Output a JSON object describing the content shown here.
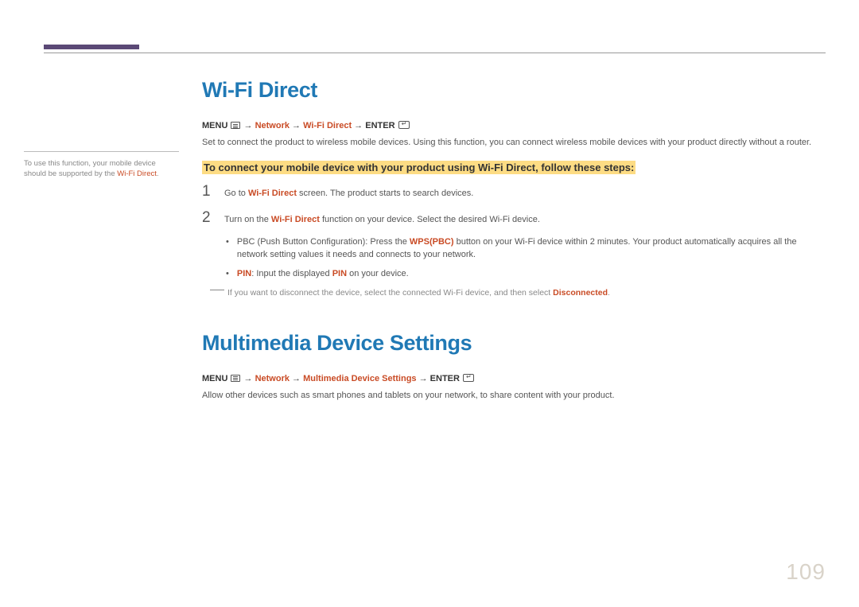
{
  "sidebar": {
    "prefix": "To use this function, your mobile device should be supported by the ",
    "highlight": "Wi-Fi Direct",
    "suffix": "."
  },
  "wifi": {
    "heading": "Wi-Fi Direct",
    "path": {
      "menu": "MENU",
      "arrow": " → ",
      "p1": "Network",
      "p2": "Wi-Fi Direct",
      "enter": "ENTER"
    },
    "desc": "Set to connect the product to wireless mobile devices. Using this function, you can connect wireless mobile devices with your product directly without a router.",
    "steps_title": "To connect your mobile device with your product using Wi-Fi Direct, follow these steps:",
    "step1_num": "1",
    "step1_a": "Go to ",
    "step1_hl": "Wi-Fi Direct",
    "step1_b": " screen. The product starts to search devices.",
    "step2_num": "2",
    "step2_a": "Turn on the ",
    "step2_hl": "Wi-Fi Direct",
    "step2_b": " function on your device. Select the desired Wi-Fi device.",
    "bullet1_a": "PBC (Push Button Configuration): Press the ",
    "bullet1_hl": "WPS(PBC)",
    "bullet1_b": " button on your Wi-Fi device within 2 minutes. Your product automatically acquires all the network setting values it needs and connects to your network.",
    "bullet2_hl1": "PIN",
    "bullet2_a": ": Input the displayed ",
    "bullet2_hl2": "PIN",
    "bullet2_b": " on your device.",
    "note_a": "If you want to disconnect the device, select the connected Wi-Fi device, and then select ",
    "note_hl": "Disconnected",
    "note_b": "."
  },
  "multimedia": {
    "heading": "Multimedia Device Settings",
    "path": {
      "menu": "MENU",
      "arrow": " → ",
      "p1": "Network",
      "p2": "Multimedia Device Settings",
      "enter": "ENTER"
    },
    "desc": "Allow other devices such as smart phones and tablets on your network, to share content with your product."
  },
  "page_number": "109"
}
